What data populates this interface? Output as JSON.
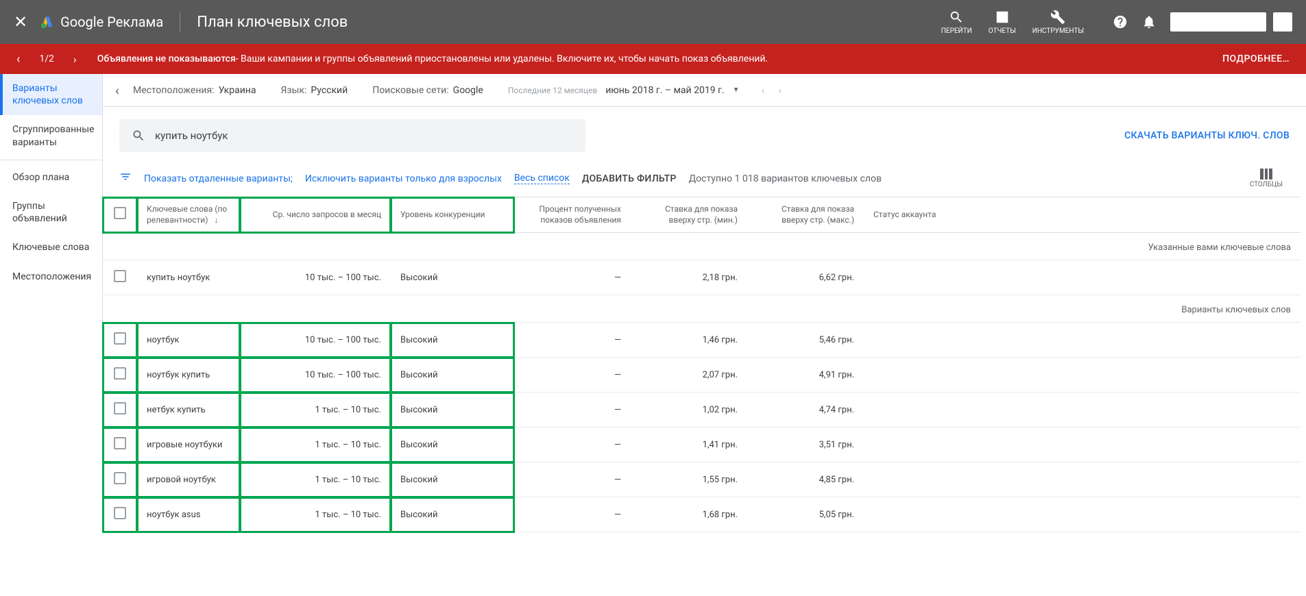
{
  "topbar": {
    "product_name": "Google Реклама",
    "page_title": "План ключевых слов",
    "tools": {
      "go": "ПЕРЕЙТИ",
      "reports": "ОТЧЕТЫ",
      "instruments": "ИНСТРУМЕНТЫ"
    }
  },
  "alert": {
    "page": "1/2",
    "bold": "Объявления не показываются",
    "rest": " - Ваши кампании и группы объявлений приостановлены или удалены. Включите их, чтобы начать показ объявлений.",
    "more": "ПОДРОБНЕЕ…"
  },
  "filters": {
    "loc_label": "Местоположения:",
    "loc_value": "Украина",
    "lang_label": "Язык:",
    "lang_value": "Русский",
    "net_label": "Поисковые сети:",
    "net_value": "Google",
    "period_label": "Последние 12 месяцев",
    "period_value": "июнь 2018 г. – май 2019 г."
  },
  "sidebar": {
    "items": [
      "Варианты ключевых слов",
      "Сгруппированные варианты",
      "Обзор плана",
      "Группы объявлений",
      "Ключевые слова",
      "Местоположения"
    ]
  },
  "search": {
    "value": "купить ноутбук"
  },
  "download_link": "СКАЧАТЬ ВАРИАНТЫ КЛЮЧ. СЛОВ",
  "controls": {
    "show_remote": "Показать отдаленные варианты;",
    "exclude_adult": "Исключить варианты только для взрослых",
    "full_list": "Весь список",
    "add_filter": "ДОБАВИТЬ ФИЛЬТР",
    "available": "Доступно 1 018 вариантов ключевых слов",
    "columns": "СТОЛБЦЫ"
  },
  "table": {
    "headers": {
      "kw": "Ключевые слова (по релевантности)",
      "avg": "Ср. число запросов в месяц",
      "comp": "Уровень конкуренции",
      "imp": "Процент полученных показов объявления",
      "bid_min": "Ставка для показа вверху стр. (мин.)",
      "bid_max": "Ставка для показа вверху стр. (макс.)",
      "status": "Статус аккаунта"
    },
    "sections": {
      "provided": "Указанные вами ключевые слова",
      "variants": "Варианты ключевых слов"
    },
    "provided_rows": [
      {
        "kw": "купить ноутбук",
        "avg": "10 тыс. – 100 тыс.",
        "comp": "Высокий",
        "imp": "—",
        "min": "2,18 грн.",
        "max": "6,62 грн.",
        "status": ""
      }
    ],
    "variant_rows": [
      {
        "kw": "ноутбук",
        "avg": "10 тыс. – 100 тыс.",
        "comp": "Высокий",
        "imp": "—",
        "min": "1,46 грн.",
        "max": "5,46 грн.",
        "status": ""
      },
      {
        "kw": "ноутбук купить",
        "avg": "10 тыс. – 100 тыс.",
        "comp": "Высокий",
        "imp": "—",
        "min": "2,07 грн.",
        "max": "4,91 грн.",
        "status": ""
      },
      {
        "kw": "нетбук купить",
        "avg": "1 тыс. – 10 тыс.",
        "comp": "Высокий",
        "imp": "—",
        "min": "1,02 грн.",
        "max": "4,74 грн.",
        "status": ""
      },
      {
        "kw": "игровые ноутбуки",
        "avg": "1 тыс. – 10 тыс.",
        "comp": "Высокий",
        "imp": "—",
        "min": "1,41 грн.",
        "max": "3,51 грн.",
        "status": ""
      },
      {
        "kw": "игровой ноутбук",
        "avg": "1 тыс. – 10 тыс.",
        "comp": "Высокий",
        "imp": "—",
        "min": "1,55 грн.",
        "max": "4,85 грн.",
        "status": ""
      },
      {
        "kw": "ноутбук asus",
        "avg": "1 тыс. – 10 тыс.",
        "comp": "Высокий",
        "imp": "—",
        "min": "1,68 грн.",
        "max": "5,05 грн.",
        "status": ""
      }
    ]
  }
}
